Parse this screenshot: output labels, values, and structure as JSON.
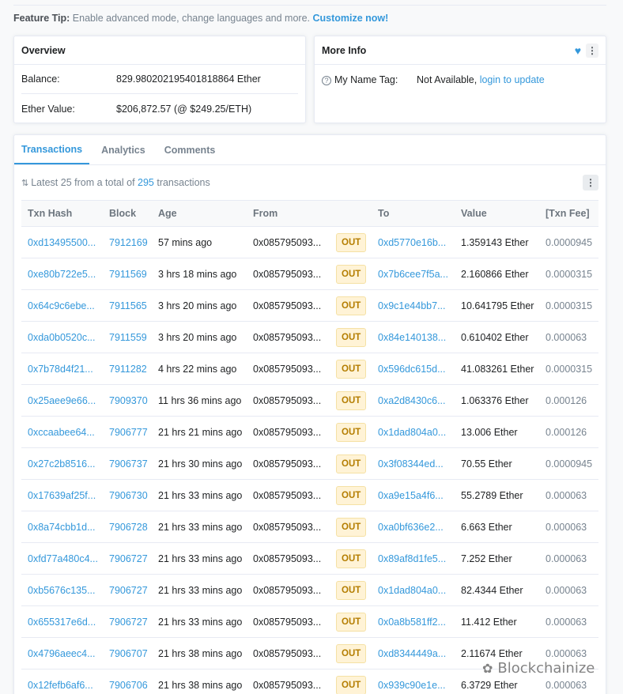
{
  "feature_tip": {
    "label": "Feature Tip:",
    "text": " Enable advanced mode, change languages and more. ",
    "cta": "Customize now!"
  },
  "overview": {
    "title": "Overview",
    "balance_label": "Balance:",
    "balance_value": "829.980202195401818864 Ether",
    "ether_value_label": "Ether Value:",
    "ether_value": "$206,872.57 (@ $249.25/ETH)"
  },
  "more_info": {
    "title": "More Info",
    "name_tag_label": "My Name Tag:",
    "name_tag_value": "Not Available, ",
    "name_tag_link": "login to update"
  },
  "tabs": [
    "Transactions",
    "Analytics",
    "Comments"
  ],
  "summary": {
    "prefix": "Latest 25 from a total of ",
    "count": "295",
    "suffix": " transactions"
  },
  "table": {
    "headers": [
      "Txn Hash",
      "Block",
      "Age",
      "From",
      "",
      "To",
      "Value",
      "[Txn Fee]"
    ],
    "rows": [
      {
        "hash": "0xd13495500...",
        "block": "7912169",
        "age": "57 mins ago",
        "from": "0x085795093...",
        "dir": "OUT",
        "to": "0xd5770e16b...",
        "value": "1.359143 Ether",
        "fee": "0.0000945"
      },
      {
        "hash": "0xe80b722e5...",
        "block": "7911569",
        "age": "3 hrs 18 mins ago",
        "from": "0x085795093...",
        "dir": "OUT",
        "to": "0x7b6cee7f5a...",
        "value": "2.160866 Ether",
        "fee": "0.0000315"
      },
      {
        "hash": "0x64c9c6ebe...",
        "block": "7911565",
        "age": "3 hrs 20 mins ago",
        "from": "0x085795093...",
        "dir": "OUT",
        "to": "0x9c1e44bb7...",
        "value": "10.641795 Ether",
        "fee": "0.0000315"
      },
      {
        "hash": "0xda0b0520c...",
        "block": "7911559",
        "age": "3 hrs 20 mins ago",
        "from": "0x085795093...",
        "dir": "OUT",
        "to": "0x84e140138...",
        "value": "0.610402 Ether",
        "fee": "0.000063"
      },
      {
        "hash": "0x7b78d4f21...",
        "block": "7911282",
        "age": "4 hrs 22 mins ago",
        "from": "0x085795093...",
        "dir": "OUT",
        "to": "0x596dc615d...",
        "value": "41.083261 Ether",
        "fee": "0.0000315"
      },
      {
        "hash": "0x25aee9e66...",
        "block": "7909370",
        "age": "11 hrs 36 mins ago",
        "from": "0x085795093...",
        "dir": "OUT",
        "to": "0xa2d8430c6...",
        "value": "1.063376 Ether",
        "fee": "0.000126"
      },
      {
        "hash": "0xccaabee64...",
        "block": "7906777",
        "age": "21 hrs 21 mins ago",
        "from": "0x085795093...",
        "dir": "OUT",
        "to": "0x1dad804a0...",
        "value": "13.006 Ether",
        "fee": "0.000126"
      },
      {
        "hash": "0x27c2b8516...",
        "block": "7906737",
        "age": "21 hrs 30 mins ago",
        "from": "0x085795093...",
        "dir": "OUT",
        "to": "0x3f08344ed...",
        "value": "70.55 Ether",
        "fee": "0.0000945"
      },
      {
        "hash": "0x17639af25f...",
        "block": "7906730",
        "age": "21 hrs 33 mins ago",
        "from": "0x085795093...",
        "dir": "OUT",
        "to": "0xa9e15a4f6...",
        "value": "55.2789 Ether",
        "fee": "0.000063"
      },
      {
        "hash": "0x8a74cbb1d...",
        "block": "7906728",
        "age": "21 hrs 33 mins ago",
        "from": "0x085795093...",
        "dir": "OUT",
        "to": "0xa0bf636e2...",
        "value": "6.663 Ether",
        "fee": "0.000063"
      },
      {
        "hash": "0xfd77a480c4...",
        "block": "7906727",
        "age": "21 hrs 33 mins ago",
        "from": "0x085795093...",
        "dir": "OUT",
        "to": "0x89af8d1fe5...",
        "value": "7.252 Ether",
        "fee": "0.000063"
      },
      {
        "hash": "0xb5676c135...",
        "block": "7906727",
        "age": "21 hrs 33 mins ago",
        "from": "0x085795093...",
        "dir": "OUT",
        "to": "0x1dad804a0...",
        "value": "82.4344 Ether",
        "fee": "0.000063"
      },
      {
        "hash": "0x655317e6d...",
        "block": "7906727",
        "age": "21 hrs 33 mins ago",
        "from": "0x085795093...",
        "dir": "OUT",
        "to": "0x0a8b581ff2...",
        "value": "11.412 Ether",
        "fee": "0.000063"
      },
      {
        "hash": "0x4796aeec4...",
        "block": "7906707",
        "age": "21 hrs 38 mins ago",
        "from": "0x085795093...",
        "dir": "OUT",
        "to": "0xd8344449a...",
        "value": "2.11674 Ether",
        "fee": "0.000063"
      },
      {
        "hash": "0x12fefb6af6...",
        "block": "7906706",
        "age": "21 hrs 38 mins ago",
        "from": "0x085795093...",
        "dir": "OUT",
        "to": "0x939c90e1e...",
        "value": "6.3729 Ether",
        "fee": "0.000063"
      }
    ]
  },
  "watermark": "Blockchainize",
  "icons": {
    "heart": "heart-icon",
    "kebab": "more-options-icon",
    "question": "question-circle-icon",
    "sort": "sort-icon",
    "wechat": "wechat-icon"
  },
  "colors": {
    "accent": "#3498db",
    "out_badge_bg": "#fff3d6",
    "out_badge_text": "#b47d00"
  }
}
